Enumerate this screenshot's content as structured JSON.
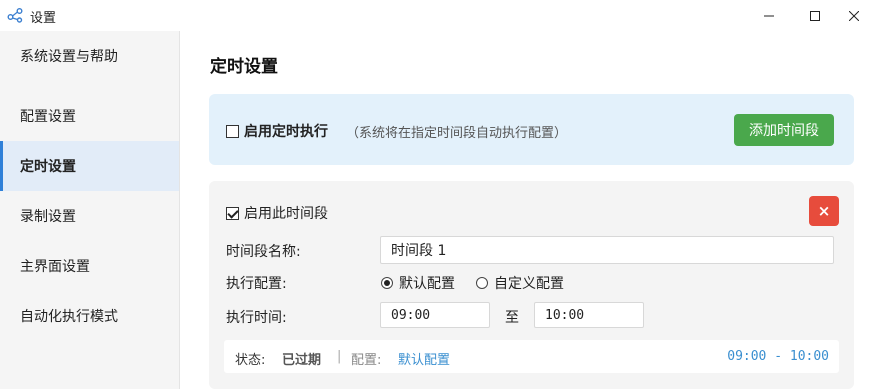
{
  "window": {
    "title": "设置",
    "icon": "app-share-icon"
  },
  "sidebar": {
    "items": [
      {
        "label": "系统设置与帮助",
        "active": false
      },
      {
        "label": "配置设置",
        "active": false
      },
      {
        "label": "定时设置",
        "active": true
      },
      {
        "label": "录制设置",
        "active": false
      },
      {
        "label": "主界面设置",
        "active": false
      },
      {
        "label": "自动化执行模式",
        "active": false
      }
    ]
  },
  "main": {
    "title": "定时设置",
    "schedule": {
      "enable_label": "启用定时执行",
      "enabled": false,
      "hint": "（系统将在指定时间段自动执行配置）",
      "add_button": "添加时间段"
    },
    "period": {
      "enable_label": "启用此时间段",
      "enabled": true,
      "delete_button": "×",
      "name_label": "时间段名称:",
      "name_value": "时间段 1",
      "config_label": "执行配置:",
      "config_options": [
        {
          "label": "默认配置",
          "selected": true
        },
        {
          "label": "自定义配置",
          "selected": false
        }
      ],
      "time_label": "执行时间:",
      "start_time": "09:00",
      "to_label": "至",
      "end_time": "10:00",
      "status": {
        "status_label": "状态:",
        "status_value": "已过期",
        "separator": "|",
        "config_label": "配置:",
        "config_value": "默认配置",
        "time_range": "09:00 - 10:00"
      }
    }
  },
  "colors": {
    "accent": "#2f80d8",
    "add_button": "#4aa84c",
    "delete_button": "#e74c3c",
    "schedule_panel": "#e3f1fb",
    "link_blue": "#3a8fd0"
  }
}
